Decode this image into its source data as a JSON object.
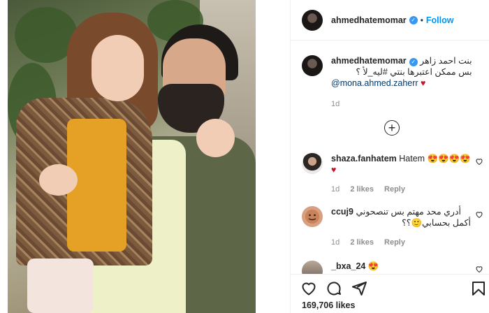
{
  "header": {
    "username": "ahmedhatemomar",
    "separator": "•",
    "follow_label": "Follow"
  },
  "caption": {
    "username": "ahmedhatemomar",
    "line1": "بنت احمد زاهر",
    "line2": "بس ممكن اعتبرها بنتي #ليه_لأ ؟",
    "mention": "@mona.ahmed.zaherr",
    "heart": "♥",
    "time": "1d"
  },
  "comments": [
    {
      "username": "shaza.fanhatem",
      "text": "Hatem",
      "emojis": "😍😍😍😍",
      "heart": "♥",
      "time": "1d",
      "likes": "2 likes",
      "reply": "Reply"
    },
    {
      "username": "ccuj9",
      "text_line1": "أدري محد مهتم بس تنصحوني",
      "text_line2": "أكمل بحسابي🙂؟؟",
      "time": "1d",
      "likes": "2 likes",
      "reply": "Reply"
    },
    {
      "username": "_bxa_24",
      "emojis": "😍"
    }
  ],
  "footer": {
    "likes": "169,706 likes"
  },
  "colors": {
    "follow_blue": "#0095f6",
    "verified_blue": "#3897f0",
    "heart_red": "#c0172c",
    "meta_gray": "#8e8e8e"
  },
  "icons": [
    "heart-icon",
    "comment-icon",
    "share-icon",
    "bookmark-icon",
    "plus-circle-icon",
    "verified-icon"
  ]
}
